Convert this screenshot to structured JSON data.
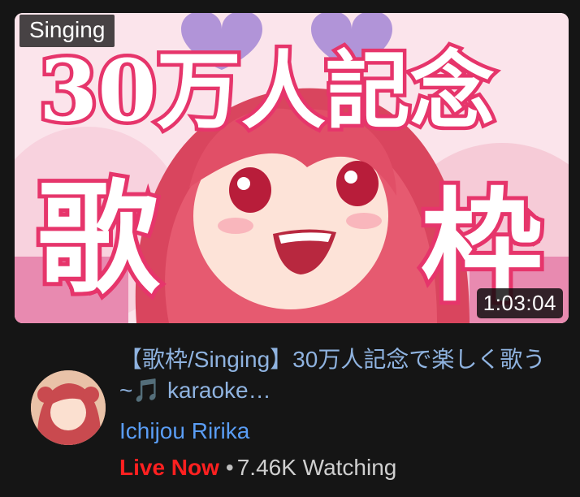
{
  "video": {
    "category_badge": "Singing",
    "duration": "1:03:04",
    "thumbnail": {
      "headline": "30万人記念",
      "char_left": "歌",
      "char_right": "枠"
    },
    "title": "【歌枠/Singing】30万人記念で楽しく歌う~🎵 karaoke…",
    "channel": "Ichijou Ririka",
    "live_label": "Live Now",
    "separator": "•",
    "viewers": "7.46K Watching"
  },
  "colors": {
    "background": "#151515",
    "title": "#8fb3e0",
    "channel": "#5a9df5",
    "live": "#ff2020",
    "accent_pink": "#e6356b"
  }
}
